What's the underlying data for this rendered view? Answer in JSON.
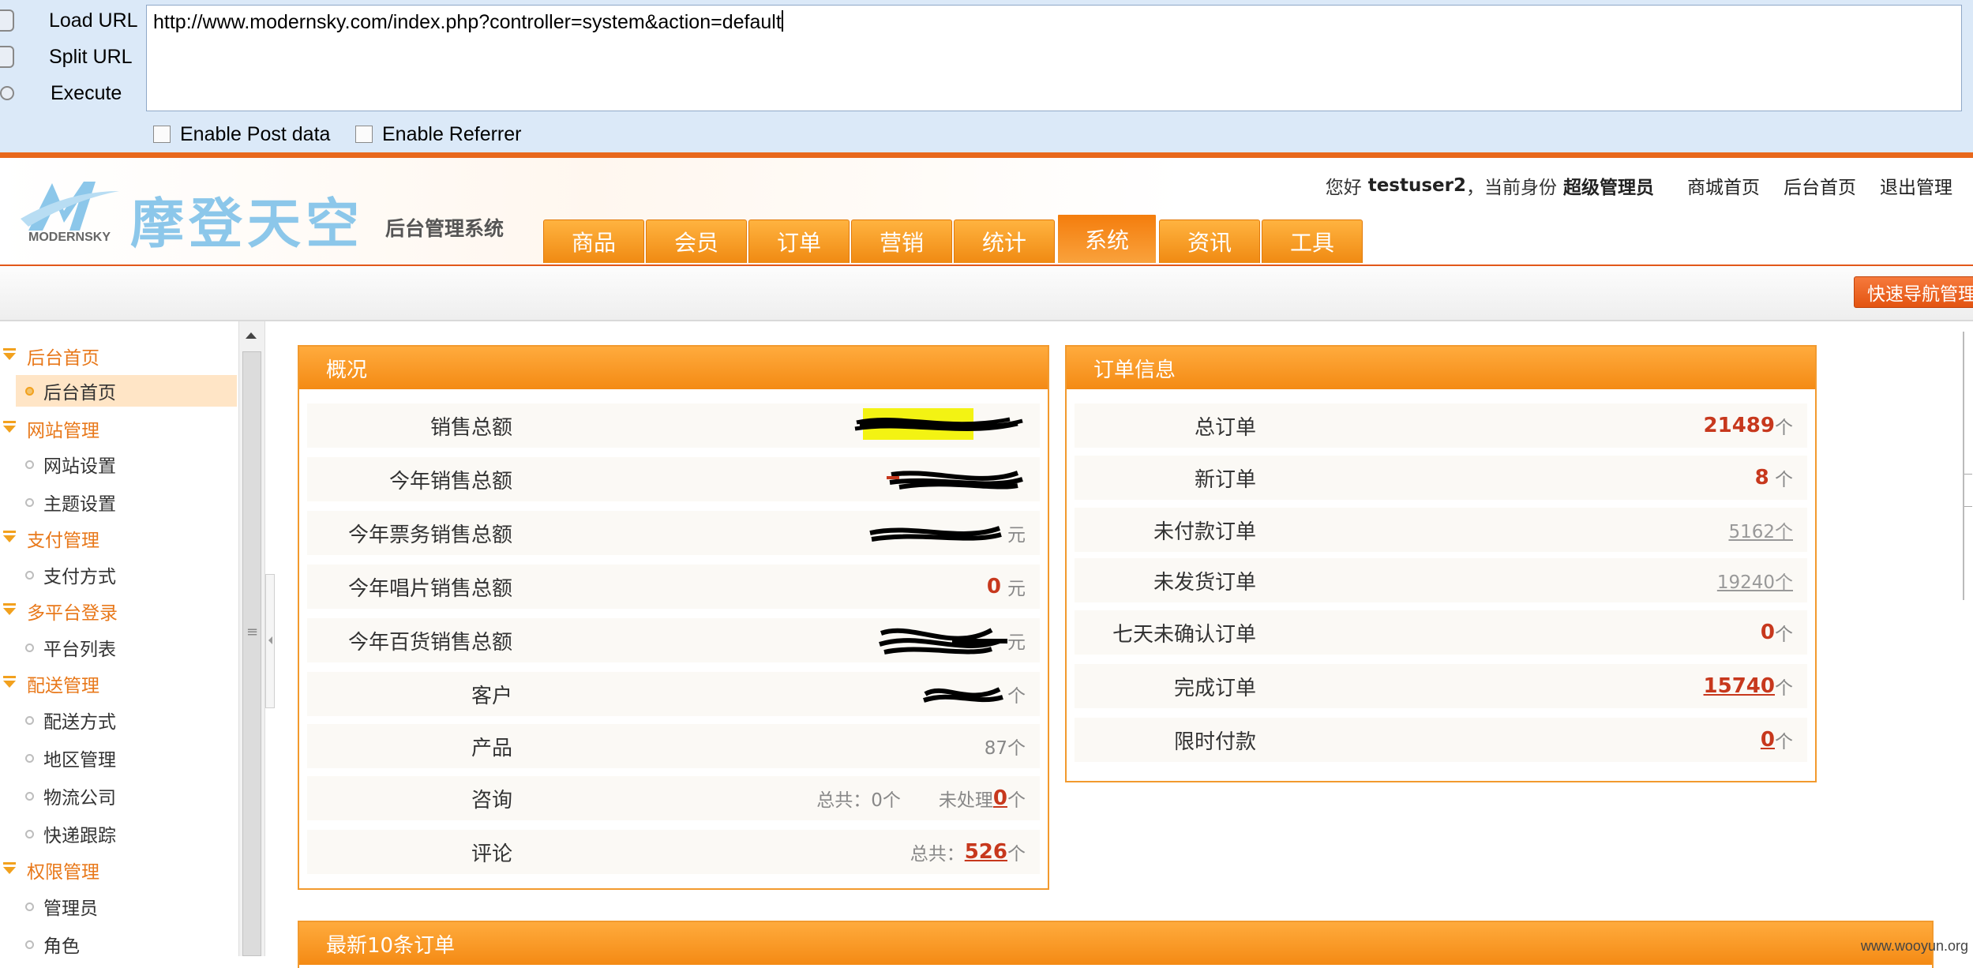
{
  "hackbar": {
    "buttons": [
      {
        "label": "Load URL",
        "icon": "load-url-icon"
      },
      {
        "label": "Split URL",
        "icon": "split-url-icon"
      },
      {
        "label": "Execute",
        "icon": "execute-icon"
      }
    ],
    "url": "http://www.modernsky.com/index.php?controller=system&action=default",
    "enable_post_label": "Enable Post data",
    "enable_referrer_label": "Enable Referrer"
  },
  "header": {
    "logo_text": "摩登天空",
    "logo_en": "MODERNSKY",
    "system_name": "后台管理系统",
    "greeting": "您好",
    "username": "testuser2",
    "identity_prefix": "，当前身份",
    "role": "超级管理员",
    "links": [
      "商城首页",
      "后台首页",
      "退出管理"
    ]
  },
  "nav": {
    "tabs": [
      "商品",
      "会员",
      "订单",
      "营销",
      "统计",
      "系统",
      "资讯",
      "工具"
    ],
    "active": "系统"
  },
  "subbar": {
    "quick_nav": "快速导航管理"
  },
  "sidebar": {
    "sections": [
      {
        "title": "后台首页",
        "items": [
          "后台首页"
        ]
      },
      {
        "title": "网站管理",
        "items": [
          "网站设置",
          "主题设置"
        ]
      },
      {
        "title": "支付管理",
        "items": [
          "支付方式"
        ]
      },
      {
        "title": "多平台登录",
        "items": [
          "平台列表"
        ]
      },
      {
        "title": "配送管理",
        "items": [
          "配送方式",
          "地区管理",
          "物流公司",
          "快递跟踪"
        ]
      },
      {
        "title": "权限管理",
        "items": [
          "管理员",
          "角色"
        ]
      }
    ],
    "active_item": "后台首页"
  },
  "overview": {
    "title": "概况",
    "rows": [
      {
        "label": "销售总额",
        "value": "",
        "unit": "",
        "redacted": true
      },
      {
        "label": "今年销售总额",
        "value": "",
        "unit": "",
        "redacted": true
      },
      {
        "label": "今年票务销售总额",
        "value": "",
        "unit": "元",
        "redacted": true
      },
      {
        "label": "今年唱片销售总额",
        "value": "0",
        "unit": "元"
      },
      {
        "label": "今年百货销售总额",
        "value": "",
        "unit": "元",
        "redacted": true
      },
      {
        "label": "客户",
        "value": "",
        "unit": "个",
        "redacted": true
      },
      {
        "label": "产品",
        "value": "87个",
        "unit": ""
      },
      {
        "label": "咨询",
        "total_label": "总共：0个",
        "pending_label": "未处理",
        "pending_value": "0",
        "unit": "个"
      },
      {
        "label": "评论",
        "total_label": "总共：",
        "value": "526",
        "unit": "个"
      }
    ]
  },
  "orders": {
    "title": "订单信息",
    "rows": [
      {
        "label": "总订单",
        "value": "21489",
        "unit": "个"
      },
      {
        "label": "新订单",
        "value": "8",
        "unit": " 个"
      },
      {
        "label": "未付款订单",
        "value": "5162个",
        "unit": ""
      },
      {
        "label": "未发货订单",
        "value": "19240个",
        "unit": ""
      },
      {
        "label": "七天未确认订单",
        "value": "0",
        "unit": "个"
      },
      {
        "label": "完成订单",
        "value": "15740",
        "unit": "个"
      },
      {
        "label": "限时付款",
        "value": "0",
        "unit": "个"
      }
    ]
  },
  "latest_orders": {
    "title": "最新10条订单"
  },
  "watermark": "www.wooyun.org",
  "colors": {
    "accent": "#f48a14",
    "highlight": "#c7381d",
    "link": "#e8781a"
  }
}
